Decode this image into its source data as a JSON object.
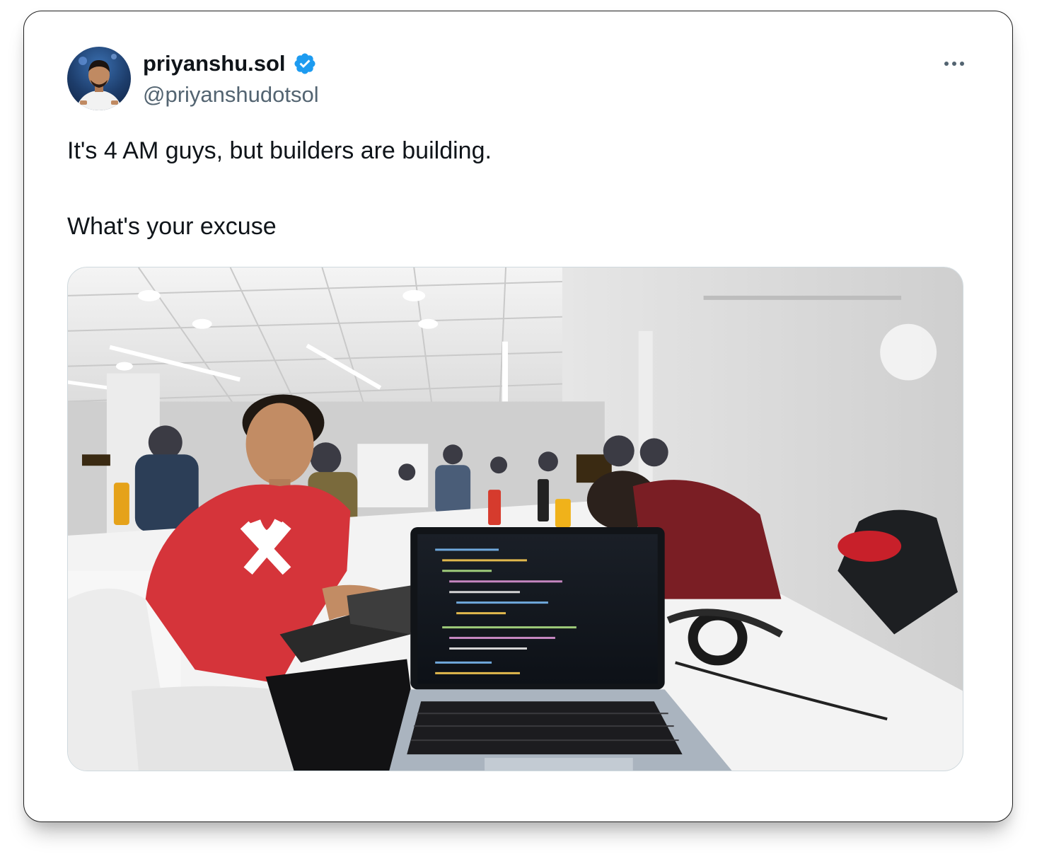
{
  "tweet": {
    "author": {
      "display_name": "priyanshu.sol",
      "handle": "@priyanshudotsol",
      "verified": true,
      "avatar_icon": "profile-photo-avatar"
    },
    "more_icon": "more-options-icon",
    "text_lines": [
      "It's 4 AM guys, but builders are building.",
      "What's your excuse"
    ],
    "media": {
      "type": "photo",
      "icon": "hackathon-photo"
    }
  },
  "colors": {
    "text_primary": "#0f1419",
    "text_secondary": "#536471",
    "verified_blue": "#1d9bf0",
    "card_border": "#1f1f1f"
  }
}
